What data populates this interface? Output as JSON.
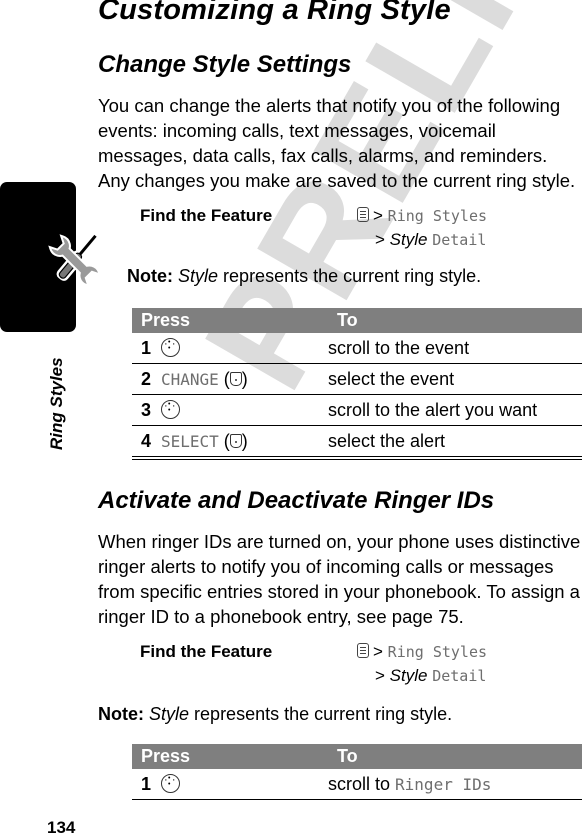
{
  "watermark": "PRELIMINARY",
  "side_tab": {
    "label": "Ring Styles",
    "icon": "wrench-screwdriver-icon"
  },
  "page_number": "134",
  "title": "Customizing a Ring Style",
  "section1": {
    "heading": "Change Style Settings",
    "paragraph": "You can change the alerts that notify you of the following events: incoming calls, text messages, voicemail messages, data calls, fax calls, alarms, and reminders. Any changes you make are saved to the current ring style.",
    "find_feature": {
      "label": "Find the Feature",
      "menu_icon": "menu-key-icon",
      "sep": ">",
      "step1": "Ring Styles",
      "step2_italic": "Style",
      "step2_mono": "Detail"
    },
    "note": {
      "label": "Note:",
      "italic": "Style",
      "text": " represents the current ring style."
    },
    "table": {
      "headers": [
        "Press",
        "To"
      ],
      "rows": [
        {
          "num": "1",
          "key_icon": "nav-key-icon",
          "key_label": "",
          "action": "scroll to the event"
        },
        {
          "num": "2",
          "key_icon": "soft-key-icon",
          "key_label": "CHANGE",
          "action": "select the event"
        },
        {
          "num": "3",
          "key_icon": "nav-key-icon",
          "key_label": "",
          "action": "scroll to the alert you want"
        },
        {
          "num": "4",
          "key_icon": "soft-key-icon",
          "key_label": "SELECT",
          "action": "select the alert"
        }
      ]
    }
  },
  "section2": {
    "heading": "Activate and Deactivate Ringer IDs",
    "paragraph": "When ringer IDs are turned on, your phone uses distinctive ringer alerts to notify you of incoming calls or messages from specific entries stored in your phonebook. To assign a ringer ID to a phonebook entry, see page 75.",
    "find_feature": {
      "label": "Find the Feature",
      "menu_icon": "menu-key-icon",
      "sep": ">",
      "step1": "Ring Styles",
      "step2_italic": "Style",
      "step2_mono": "Detail"
    },
    "note": {
      "label": "Note:",
      "italic": "Style",
      "text": " represents the current ring style."
    },
    "table": {
      "headers": [
        "Press",
        "To"
      ],
      "rows": [
        {
          "num": "1",
          "key_icon": "nav-key-icon",
          "action_prefix": "scroll to ",
          "action_mono": "Ringer IDs"
        }
      ]
    }
  }
}
